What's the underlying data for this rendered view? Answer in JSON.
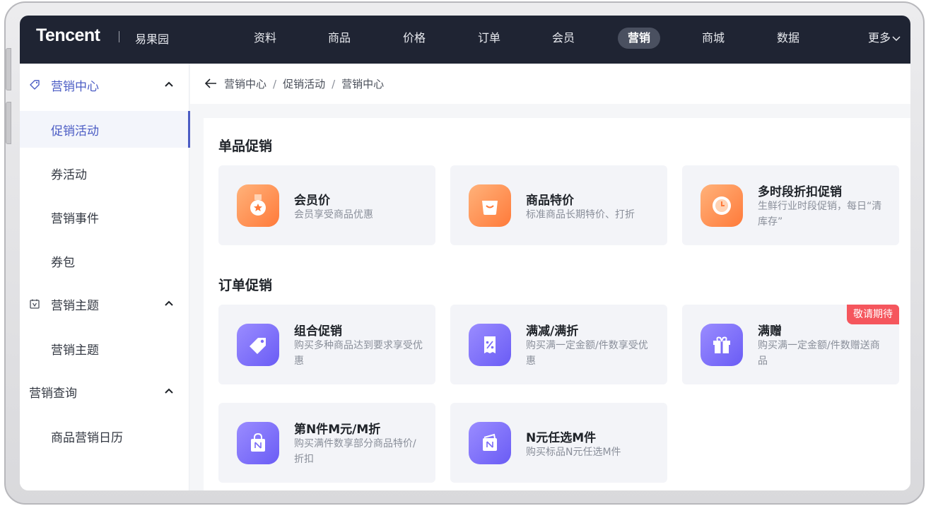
{
  "topnav": {
    "brand": "Tencent",
    "store": "易果园",
    "items": [
      {
        "label": "资料",
        "active": false
      },
      {
        "label": "商品",
        "active": false
      },
      {
        "label": "价格",
        "active": false
      },
      {
        "label": "订单",
        "active": false
      },
      {
        "label": "会员",
        "active": false
      },
      {
        "label": "营销",
        "active": true
      },
      {
        "label": "商城",
        "active": false
      },
      {
        "label": "数据",
        "active": false
      }
    ],
    "more_label": "更多"
  },
  "sidebar": {
    "groups": [
      {
        "label": "营销中心",
        "icon": "tag-icon",
        "expanded": true,
        "active": true,
        "items": [
          {
            "label": "促销活动",
            "active": true
          },
          {
            "label": "券活动",
            "active": false
          },
          {
            "label": "营销事件",
            "active": false
          },
          {
            "label": "券包",
            "active": false
          }
        ]
      },
      {
        "label": "营销主题",
        "icon": "calendar-icon",
        "expanded": true,
        "active": false,
        "items": [
          {
            "label": "营销主题",
            "active": false
          }
        ]
      },
      {
        "label": "营销查询",
        "icon": "",
        "expanded": true,
        "active": false,
        "items": [
          {
            "label": "商品营销日历",
            "active": false
          }
        ]
      }
    ]
  },
  "breadcrumb": {
    "back_icon": "arrow-left-icon",
    "items": [
      "营销中心",
      "促销活动",
      "营销中心"
    ],
    "separator": "/"
  },
  "sections": [
    {
      "title": "单品促销",
      "cards": [
        {
          "title": "会员价",
          "desc": "会员享受商品优惠",
          "icon": "medal-icon",
          "color": "orange"
        },
        {
          "title": "商品特价",
          "desc": "标准商品长期特价、打折",
          "icon": "shopping-bag-icon",
          "color": "orange"
        },
        {
          "title": "多时段折扣促销",
          "desc": "生鲜行业时段促销，每日“清库存”",
          "icon": "clock-icon",
          "color": "orange"
        }
      ]
    },
    {
      "title": "订单促销",
      "cards": [
        {
          "title": "组合促销",
          "desc": "购买多种商品达到要求享受优惠",
          "icon": "price-tag-icon",
          "color": "purple"
        },
        {
          "title": "满减/满折",
          "desc": "购买满一定金额/件数享受优惠",
          "icon": "percent-receipt-icon",
          "color": "purple"
        },
        {
          "title": "满赠",
          "desc": "购买满一定金额/件数赠送商品",
          "icon": "gift-icon",
          "color": "purple",
          "badge": "敬请期待"
        },
        {
          "title": "第N件M元/M折",
          "desc": "购买满件数享部分商品特价/折扣",
          "icon": "shopping-bag-icon",
          "color": "purple"
        },
        {
          "title": "N元任选M件",
          "desc": "购买标品N元任选M件",
          "icon": "wallet-icon",
          "color": "purple"
        }
      ]
    }
  ],
  "colors": {
    "nav_bg": "#1f2433",
    "accent": "#4b5cc4",
    "orange": "#ff7a3a",
    "purple": "#6a5cf5",
    "badge": "#f5565d"
  }
}
